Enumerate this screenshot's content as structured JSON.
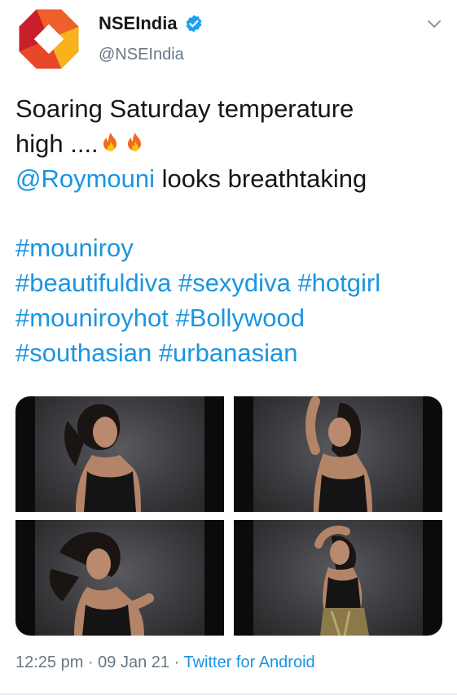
{
  "account": {
    "display_name": "NSEIndia",
    "handle": "@NSEIndia",
    "verified": true,
    "avatar_icon": "nse-logo-icon"
  },
  "tweet": {
    "line1": "Soaring Saturday temperature",
    "line2": "high ....",
    "emojis": [
      "fire-emoji",
      "fire-emoji"
    ],
    "mention": "@Roymouni",
    "mention_suffix": " looks breathtaking",
    "hashtag_lines": [
      [
        "#mouniroy"
      ],
      [
        "#beautifuldiva",
        "#sexydiva",
        "#hotgirl"
      ],
      [
        "#mouniroyhot",
        "#Bollywood"
      ],
      [
        "#southasian",
        "#urbanasian"
      ]
    ]
  },
  "media": {
    "photos": [
      {
        "alt": "photo 1"
      },
      {
        "alt": "photo 2"
      },
      {
        "alt": "photo 3"
      },
      {
        "alt": "photo 4"
      }
    ]
  },
  "meta": {
    "time": "12:25 pm",
    "separator": " · ",
    "date": "09 Jan 21",
    "source": "Twitter for Android"
  },
  "colors": {
    "link": "#1b95e0",
    "secondary_text": "#657786",
    "primary_text": "#14171a",
    "verified": "#1da1f2",
    "logo_orange": "#f0602a",
    "logo_yellow": "#f7b21c",
    "logo_red": "#e2262e"
  }
}
